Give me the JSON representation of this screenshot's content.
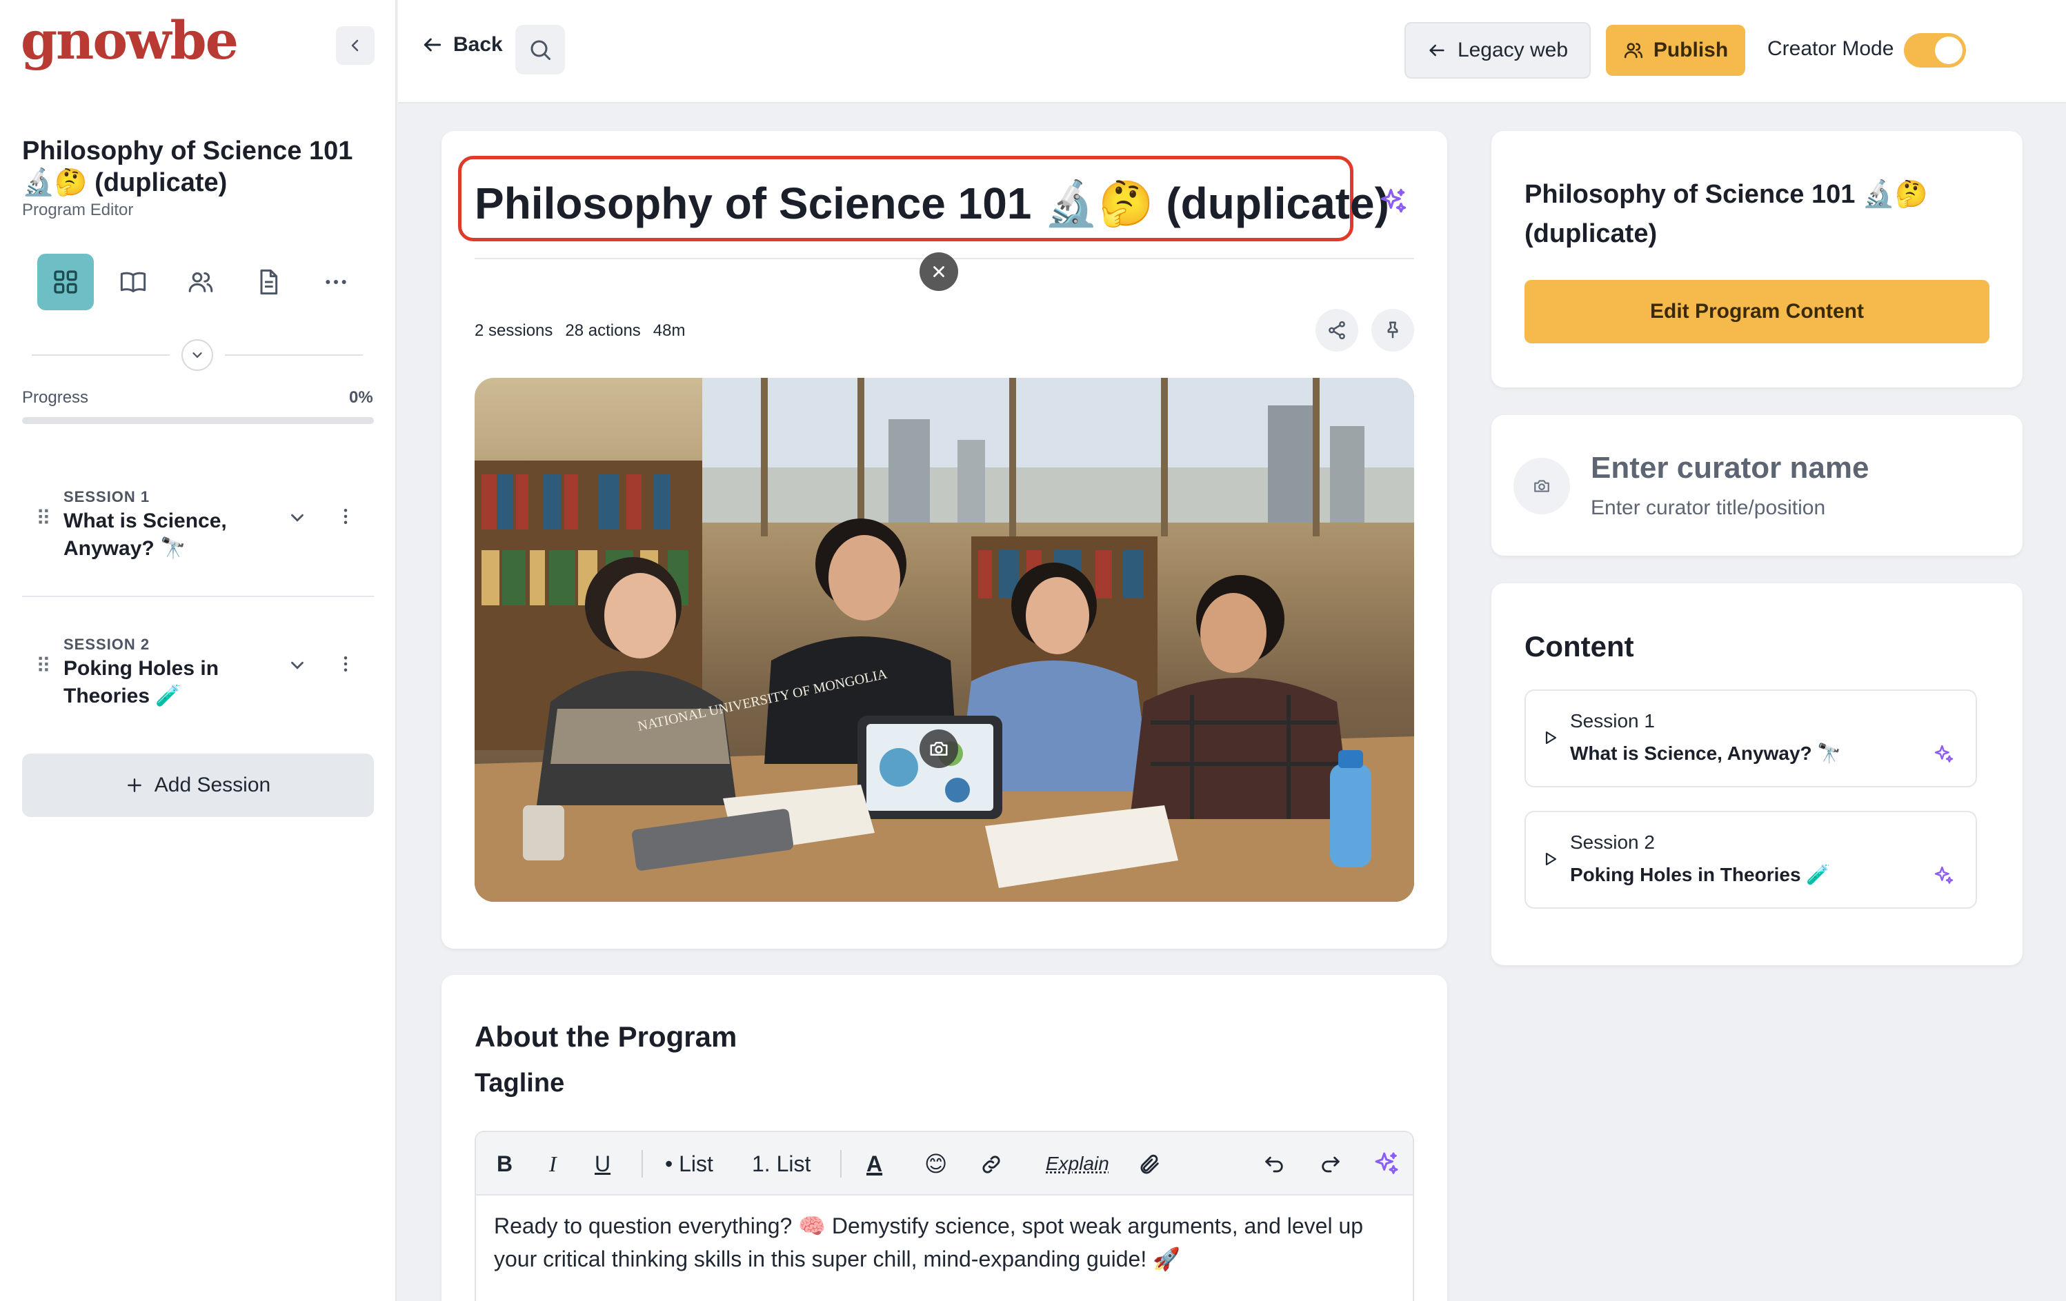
{
  "sidebar": {
    "logo": "gnowbe",
    "program_title": "Philosophy of Science 101 🔬🤔 (duplicate)",
    "program_subtitle": "Program Editor",
    "progress_label": "Progress",
    "progress_pct": "0%",
    "progress_value": 0,
    "sessions": [
      {
        "label": "SESSION 1",
        "name": "What is Science, Anyway? 🔭"
      },
      {
        "label": "SESSION 2",
        "name": "Poking Holes in Theories 🧪"
      }
    ],
    "add_session_label": "Add Session"
  },
  "topbar": {
    "back_label": "Back",
    "legacy_label": "Legacy web",
    "publish_label": "Publish",
    "creator_mode_label": "Creator Mode"
  },
  "main": {
    "title": "Philosophy of Science 101 🔬🤔 (duplicate)",
    "stats": {
      "sessions": "2 sessions",
      "actions": "28 actions",
      "duration": "48m"
    },
    "image_text": "NATIONAL UNIVERSITY OF MONGOLIA"
  },
  "about": {
    "title": "About the Program",
    "tagline_label": "Tagline",
    "toolbar": {
      "bold": "B",
      "italic": "I",
      "underline": "U",
      "bullet_list": "• List",
      "numbered_list": "1. List",
      "text_color": "A",
      "emoji": "😊",
      "explain": "Explain"
    },
    "tagline_text": "Ready to question everything? 🧠 Demystify science, spot weak arguments, and level up your critical thinking skills in this super chill, mind-expanding guide! 🚀"
  },
  "right": {
    "info_title": "Philosophy of Science 101 🔬🤔 (duplicate)",
    "edit_button": "Edit Program Content",
    "curator_name_placeholder": "Enter curator name",
    "curator_title_placeholder": "Enter curator title/position",
    "content_title": "Content",
    "content_items": [
      {
        "label": "Session 1",
        "name": "What is Science, Anyway? 🔭"
      },
      {
        "label": "Session 2",
        "name": "Poking Holes in Theories 🧪"
      }
    ]
  },
  "colors": {
    "accent_yellow": "#f6b94c",
    "teal": "#6dbfc5",
    "highlight_red": "#e03a2a",
    "sparkle_purple": "#8b5cf6",
    "logo_red": "#b83a32"
  },
  "icons": [
    "chevron-left-icon",
    "grid-icon",
    "book-icon",
    "users-icon",
    "document-icon",
    "more-icon",
    "chevron-down-icon",
    "drag-handle-icon",
    "kebab-icon",
    "plus-icon",
    "arrow-left-icon",
    "search-icon",
    "users-icon",
    "sparkle-icon",
    "share-icon",
    "pin-icon",
    "close-icon",
    "camera-icon",
    "link-icon",
    "attachment-icon",
    "undo-icon",
    "redo-icon",
    "play-icon"
  ]
}
